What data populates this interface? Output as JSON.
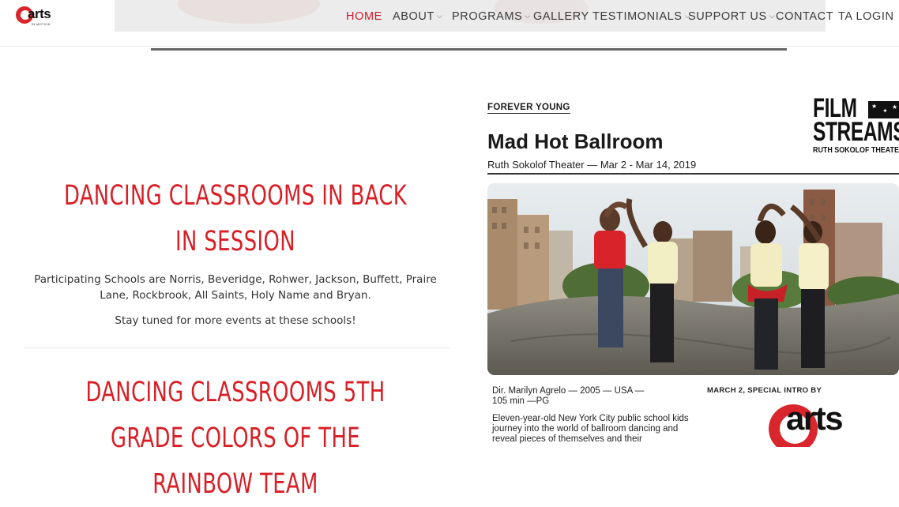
{
  "header": {
    "logo_text": "arts",
    "logo_subtext": "IN MOTION",
    "nav": [
      {
        "label": "HOME",
        "active": true,
        "dropdown": false
      },
      {
        "label": "ABOUT",
        "active": false,
        "dropdown": true
      },
      {
        "label": "PROGRAMS",
        "active": false,
        "dropdown": true
      },
      {
        "label": "GALLERY",
        "active": false,
        "dropdown": false
      },
      {
        "label": "TESTIMONIALS",
        "active": false,
        "dropdown": true
      },
      {
        "label": "SUPPORT US",
        "active": false,
        "dropdown": true
      },
      {
        "label": "CONTACT",
        "active": false,
        "dropdown": false
      },
      {
        "label": "TA LOGIN",
        "active": false,
        "dropdown": false
      }
    ],
    "chevron_glyph": "⌵"
  },
  "posts": [
    {
      "title": "DANCING CLASSROOMS IN BACK IN SESSION",
      "paragraphs": [
        "Participating Schools are Norris, Beveridge, Rohwer, Jackson, Buffett, Praire Lane, Rockbrook, All Saints, Holy Name and Bryan.",
        "Stay tuned for more events at these schools!"
      ]
    },
    {
      "title": "DANCING CLASSROOMS 5TH GRADE COLORS OF THE RAINBOW TEAM"
    }
  ],
  "poster": {
    "kicker": "FOREVER YOUNG",
    "title": "Mad Hot Ballroom",
    "theater_dates": "Ruth Sokolof Theater — Mar 2 - Mar 14, 2019",
    "brand_line1": "FILM",
    "brand_line2": "STREAMS",
    "brand_sub": "RUTH SOKOLOF THEATER",
    "credits_line1": "Dir. Marilyn Agrelo — 2005 — USA —",
    "credits_line2": "105 min —PG",
    "synopsis": "Eleven-year-old New York City public school kids journey into the world of ballroom dancing and reveal pieces of themselves and their",
    "intro_label": "MARCH 2, SPECIAL INTRO BY",
    "partner_logo_text": "arts"
  },
  "colors": {
    "accent_red": "#d81f26",
    "nav_text": "#3a3a3a",
    "body_text": "#333333"
  },
  "icons": {
    "chevron": "chevron-down-icon",
    "logo": "arts-in-motion-logo"
  }
}
